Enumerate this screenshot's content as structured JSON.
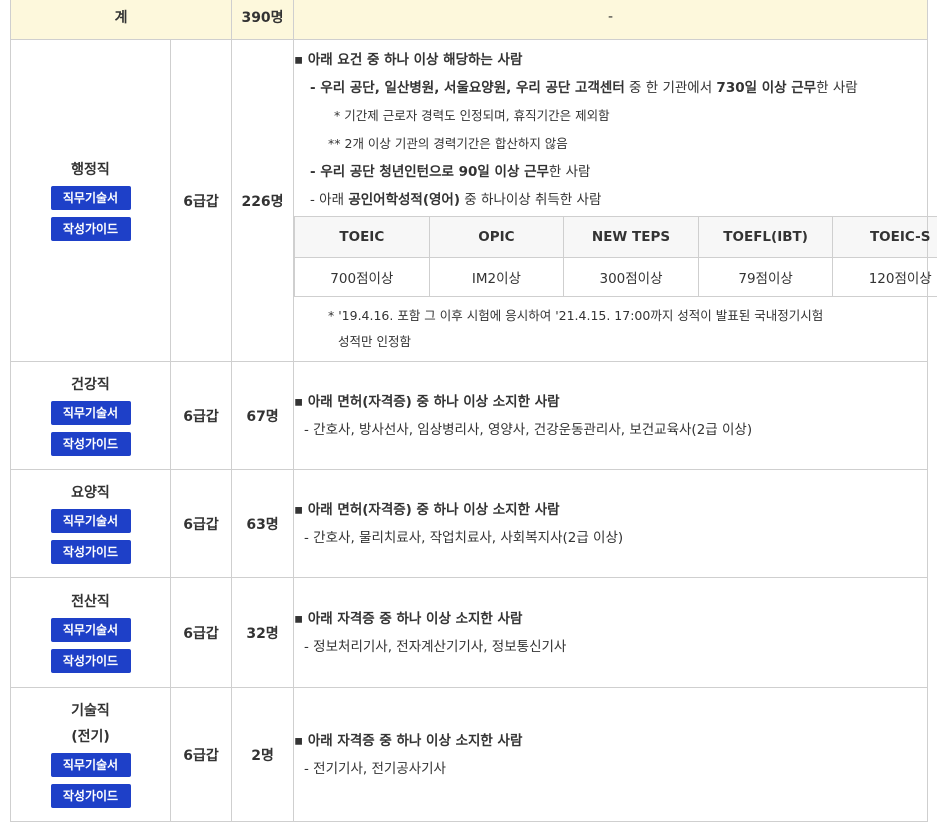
{
  "summary": {
    "label": "계",
    "count": "390명",
    "note": "-"
  },
  "buttons": {
    "duty": "직무기술서",
    "guide": "작성가이드"
  },
  "rows": [
    {
      "name": "행정직",
      "grade": "6급갑",
      "count": "226명",
      "head": "아래 요건 중 하나 이상 해당하는 사람",
      "item1_prefix": "- ",
      "item1_bold": "우리 공단, 일산병원, 서울요양원, 우리 공단 고객센터",
      "item1_mid": " 중 한 기관에서 ",
      "item1_bold2": "730일 이상 근무",
      "item1_suffix": "한 사람",
      "sub1": "* 기간제 근로자 경력도 인정되며, 휴직기간은 제외함",
      "sub2": "** 2개 이상 기관의 경력기간은 합산하지 않음",
      "item2_bold": "- 우리 공단 청년인턴으로 90일 이상 근무",
      "item2_suffix": "한 사람",
      "item3_prefix": "- 아래 ",
      "item3_bold": "공인어학성적(영어)",
      "item3_suffix": " 중 하나이상 취득한 사람",
      "scores": {
        "headers": [
          "TOEIC",
          "OPIC",
          "NEW TEPS",
          "TOEFL(IBT)",
          "TOEIC-S"
        ],
        "values": [
          "700점이상",
          "IM2이상",
          "300점이상",
          "79점이상",
          "120점이상"
        ]
      },
      "note1": "* '19.4.16. 포함 그 이후 시험에 응시하여 '21.4.15. 17:00까지 성적이 발표된 국내정기시험",
      "note2": "성적만 인정함"
    },
    {
      "name": "건강직",
      "grade": "6급갑",
      "count": "67명",
      "head": "아래 면허(자격증) 중 하나 이상 소지한 사람",
      "detail": "- 간호사, 방사선사, 임상병리사, 영양사, 건강운동관리사, 보건교육사(2급 이상)"
    },
    {
      "name": "요양직",
      "grade": "6급갑",
      "count": "63명",
      "head": "아래 면허(자격증) 중 하나 이상 소지한 사람",
      "detail": "- 간호사, 물리치료사, 작업치료사, 사회복지사(2급 이상)"
    },
    {
      "name": "전산직",
      "grade": "6급갑",
      "count": "32명",
      "head": "아래 자격증 중 하나 이상 소지한 사람",
      "detail": "- 정보처리기사, 전자계산기기사, 정보통신기사"
    },
    {
      "name": "기술직",
      "name2": "(전기)",
      "grade": "6급갑",
      "count": "2명",
      "head": "아래 자격증 중 하나 이상 소지한 사람",
      "detail": "- 전기기사, 전기공사기사"
    }
  ]
}
